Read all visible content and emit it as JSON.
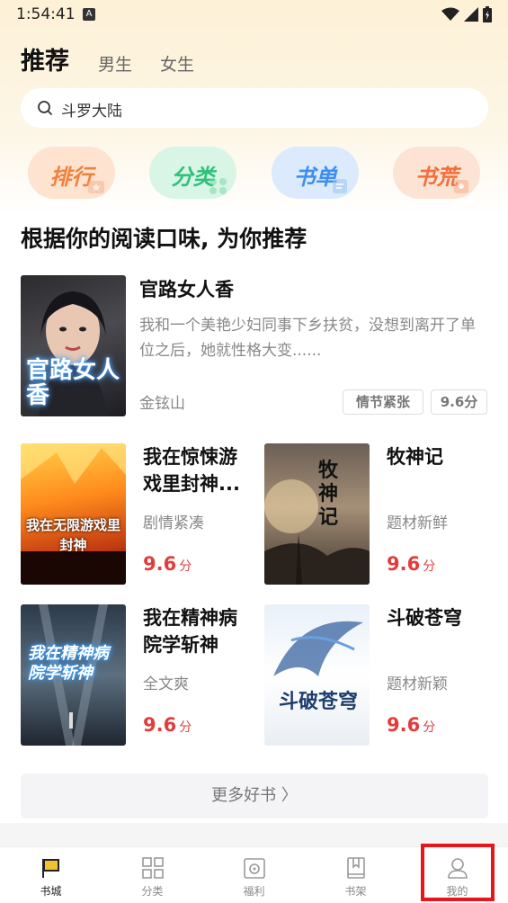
{
  "status": {
    "time": "1:54:41",
    "badge": "A"
  },
  "tabs": [
    {
      "label": "推荐"
    },
    {
      "label": "男生"
    },
    {
      "label": "女生"
    }
  ],
  "search": {
    "text": "斗罗大陆"
  },
  "categories": [
    {
      "label": "排行",
      "color": "#f0823c"
    },
    {
      "label": "分类",
      "color": "#2fc079"
    },
    {
      "label": "书单",
      "color": "#3c8eef"
    },
    {
      "label": "书荒",
      "color": "#f36e3a"
    }
  ],
  "section": {
    "title": "根据你的阅读口味, 为你推荐"
  },
  "featured": {
    "title": "官路女人香",
    "desc": "我和一个美艳少妇同事下乡扶贫，没想到离开了单位之后，她就性格大变......",
    "author": "金铉山",
    "tag": "情节紧张",
    "score": "9.6分",
    "cover_text": "官路女人香"
  },
  "books": [
    {
      "title": "我在惊悚游戏里封神...",
      "tag": "剧情紧凑",
      "score": "9.6",
      "unit": "分",
      "cover_text": "我在无限游戏里封神"
    },
    {
      "title": "牧神记",
      "tag": "题材新鲜",
      "score": "9.6",
      "unit": "分",
      "cover_text": "牧神记"
    },
    {
      "title": "我在精神病院学斩神",
      "tag": "全文爽",
      "score": "9.6",
      "unit": "分",
      "cover_text": "我在精神病院学斩神"
    },
    {
      "title": "斗破苍穹",
      "tag": "题材新颖",
      "score": "9.6",
      "unit": "分",
      "cover_text": "斗破苍穹"
    }
  ],
  "more": {
    "label": "更多好书 〉"
  },
  "nav": [
    {
      "label": "书城",
      "icon": "flag-icon"
    },
    {
      "label": "分类",
      "icon": "grid-icon"
    },
    {
      "label": "福利",
      "icon": "gift-icon"
    },
    {
      "label": "书架",
      "icon": "book-icon"
    },
    {
      "label": "我的",
      "icon": "user-icon"
    }
  ]
}
